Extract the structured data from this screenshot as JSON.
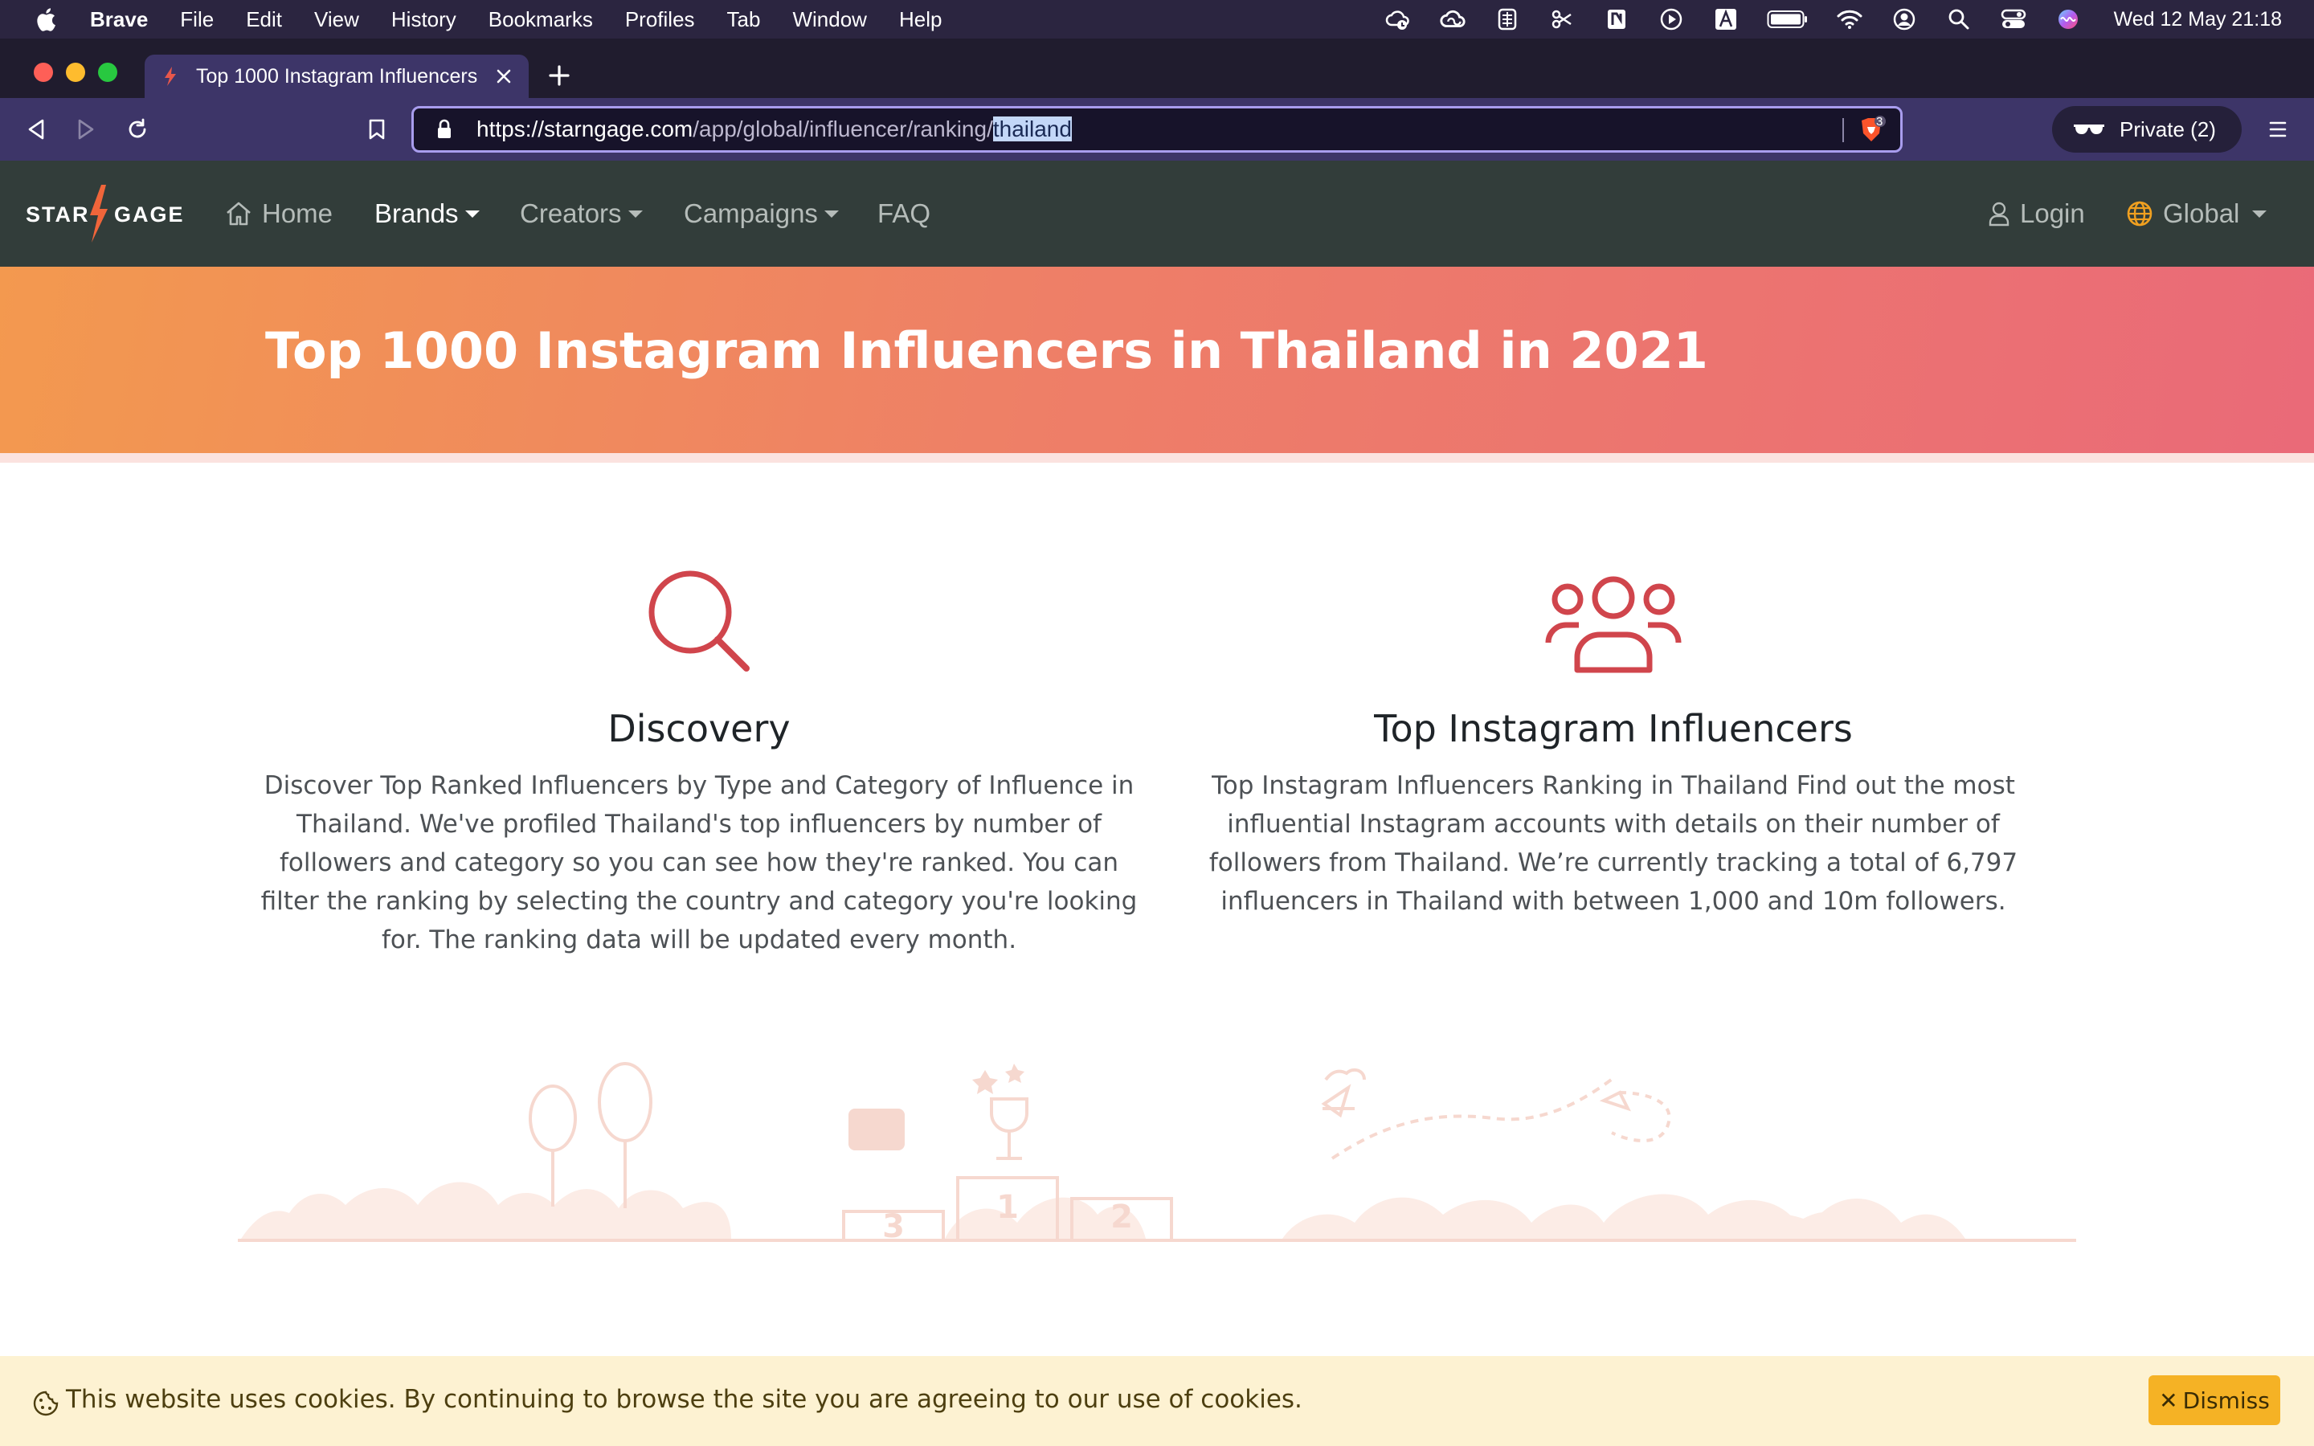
{
  "mac_menubar": {
    "app_name": "Brave",
    "menus": [
      "File",
      "Edit",
      "View",
      "History",
      "Bookmarks",
      "Profiles",
      "Tab",
      "Window",
      "Help"
    ],
    "status_icons": [
      "cloud-sync-icon",
      "creative-cloud-icon",
      "app-store-like-icon",
      "scissors-icon",
      "note-icon",
      "play-icon",
      "a-text-icon",
      "battery-icon",
      "wifi-icon",
      "user-account-icon",
      "spotlight-search-icon",
      "control-center-icon",
      "siri-icon"
    ],
    "clock": "Wed 12 May  21:18"
  },
  "browser": {
    "tab_title": "Top 1000 Instagram Influencers",
    "url": {
      "host_part": "https://starngage.com",
      "path_part": "/app/global/influencer/ranking/",
      "selected_part": "thailand"
    },
    "shield_count": "3",
    "private_label": "Private (2)",
    "icons": {
      "back": "back-icon",
      "forward": "forward-icon",
      "reload": "reload-icon",
      "bookmark": "bookmark-icon",
      "lock": "lock-icon",
      "shield": "brave-shield-icon",
      "private": "private-glasses-icon",
      "menu": "hamburger-menu-icon"
    }
  },
  "site_nav": {
    "logo_left": "STAR",
    "logo_right": "GAGE",
    "items": [
      {
        "label": "Home",
        "has_caret": false
      },
      {
        "label": "Brands",
        "has_caret": true,
        "active": true
      },
      {
        "label": "Creators",
        "has_caret": true
      },
      {
        "label": "Campaigns",
        "has_caret": true
      },
      {
        "label": "FAQ",
        "has_caret": false
      }
    ],
    "login_label": "Login",
    "region_label": "Global"
  },
  "hero": {
    "title": "Top 1000 Instagram Influencers in Thailand in 2021"
  },
  "features": [
    {
      "icon": "search-icon",
      "title": "Discovery",
      "text": "Discover Top Ranked Influencers by Type and Category of Influence in Thailand. We've profiled Thailand's top influencers by number of followers and category so you can see how they're ranked. You can filter the ranking by selecting the country and category you're looking for. The ranking data will be updated every month."
    },
    {
      "icon": "users-group-icon",
      "title": "Top Instagram Influencers",
      "text": "Top Instagram Influencers Ranking in Thailand Find out the most influential Instagram accounts with details on their number of followers from Thailand. We’re currently tracking a total of 6,797 influencers in Thailand with between 1,000 and 10m followers."
    }
  ],
  "illustration": {
    "podium": [
      "3",
      "1",
      "2"
    ]
  },
  "cookie_bar": {
    "text": "This website uses cookies. By continuing to browse the site you are agreeing to our use of cookies.",
    "dismiss_label": "Dismiss"
  },
  "colors": {
    "accent_red": "#d0454c",
    "hero_start": "#f3994f",
    "hero_end": "#ea6a78",
    "nav_bg": "#323d3a",
    "browser_chrome": "#3d3568",
    "cookie_bg": "#fdf2d2",
    "dismiss_bg": "#f5b225"
  }
}
